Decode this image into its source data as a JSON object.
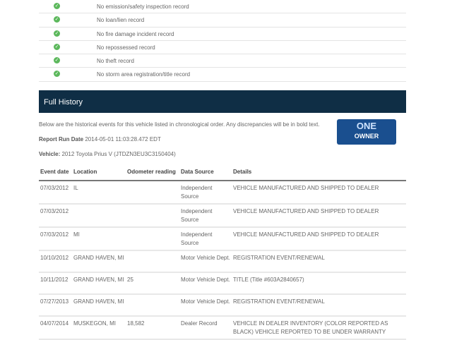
{
  "checks": [
    "No emission/safety inspection record",
    "No loan/lien record",
    "No fire damage incident record",
    "No repossessed record",
    "No theft record",
    "No storm area registration/title record"
  ],
  "section_title": "Full History",
  "intro": "Below are the historical events for this vehicle listed in chronological order. Any discrepancies will be in bold text.",
  "report_run_label": "Report Run Date",
  "report_run_value": "2014-05-01 11:03:28.472 EDT",
  "vehicle_label": "Vehicle:",
  "vehicle_value": "2012 Toyota Prius V (JTDZN3EU3C3150404)",
  "logo": {
    "top": "ONE",
    "bottom": "OWNER"
  },
  "columns": [
    "Event date",
    "Location",
    "Odometer reading",
    "Data Source",
    "Details"
  ],
  "rows": [
    [
      "07/03/2012",
      "IL",
      "",
      "Independent Source",
      "VEHICLE MANUFACTURED AND SHIPPED TO DEALER"
    ],
    [
      "07/03/2012",
      "",
      "",
      "Independent Source",
      "VEHICLE MANUFACTURED AND SHIPPED TO DEALER"
    ],
    [
      "07/03/2012",
      "MI",
      "",
      "Independent Source",
      "VEHICLE MANUFACTURED AND SHIPPED TO DEALER"
    ],
    [
      "10/10/2012",
      "GRAND HAVEN, MI",
      "",
      "Motor Vehicle Dept.",
      "REGISTRATION EVENT/RENEWAL"
    ],
    [
      "10/11/2012",
      "GRAND HAVEN, MI",
      "25",
      "Motor Vehicle Dept.",
      "TITLE (Title #603A2840657)"
    ],
    [
      "07/27/2013",
      "GRAND HAVEN, MI",
      "",
      "Motor Vehicle Dept.",
      "REGISTRATION EVENT/RENEWAL"
    ],
    [
      "04/07/2014",
      "MUSKEGON, MI",
      "18,582",
      "Dealer Record",
      "VEHICLE IN DEALER INVENTORY (COLOR REPORTED AS BLACK) VEHICLE REPORTED TO BE UNDER WARRANTY"
    ]
  ]
}
